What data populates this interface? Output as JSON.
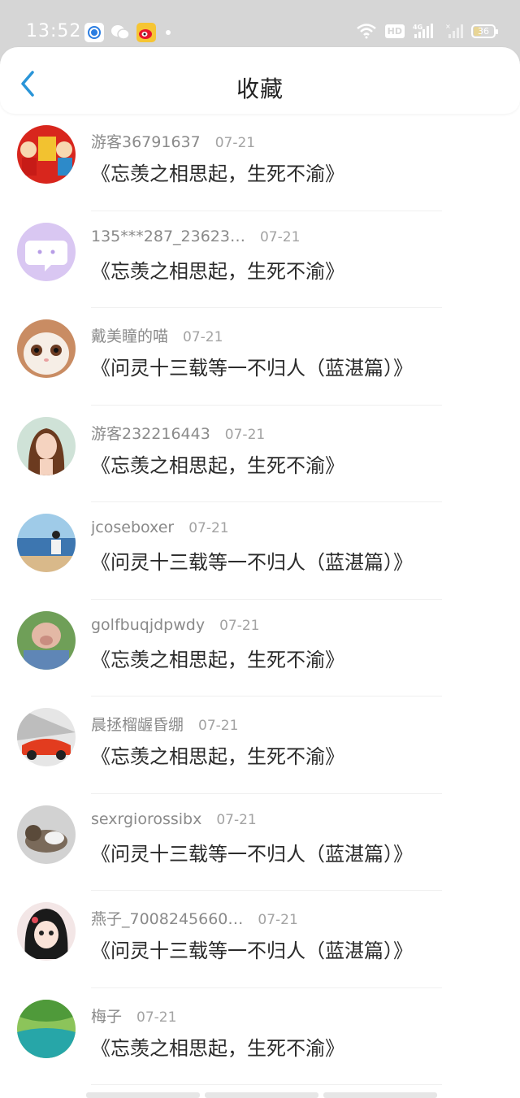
{
  "status_bar": {
    "time": "13:52",
    "network": "4G",
    "battery": "36",
    "battery_level": 0.36,
    "icons": [
      "app-icon",
      "wechat-icon",
      "weibo-icon",
      "wifi-icon",
      "hd-icon",
      "signal-icon"
    ]
  },
  "header": {
    "title": "收藏",
    "back_icon": "chevron-left-icon"
  },
  "items": [
    {
      "name": "游客36791637",
      "date": "07-21",
      "title": "《忘羡之相思起，生死不渝》"
    },
    {
      "name": "135***287_23623…",
      "date": "07-21",
      "title": "《忘羡之相思起，生死不渝》"
    },
    {
      "name": "戴美瞳的喵",
      "date": "07-21",
      "title": "《问灵十三载等一不归人（蓝湛篇）》"
    },
    {
      "name": "游客232216443",
      "date": "07-21",
      "title": "《忘羡之相思起，生死不渝》"
    },
    {
      "name": "jcoseboxer",
      "date": "07-21",
      "title": "《问灵十三载等一不归人（蓝湛篇）》"
    },
    {
      "name": "golfbuqjdpwdy",
      "date": "07-21",
      "title": "《忘羡之相思起，生死不渝》"
    },
    {
      "name": "晨拯榴龌昏绷",
      "date": "07-21",
      "title": "《忘羡之相思起，生死不渝》"
    },
    {
      "name": "sexrgiorossibx",
      "date": "07-21",
      "title": "《问灵十三载等一不归人（蓝湛篇）》"
    },
    {
      "name": "燕子_7008245660…",
      "date": "07-21",
      "title": "《问灵十三载等一不归人（蓝湛篇）》"
    },
    {
      "name": "梅子",
      "date": "07-21",
      "title": "《忘羡之相思起，生死不渝》"
    }
  ]
}
